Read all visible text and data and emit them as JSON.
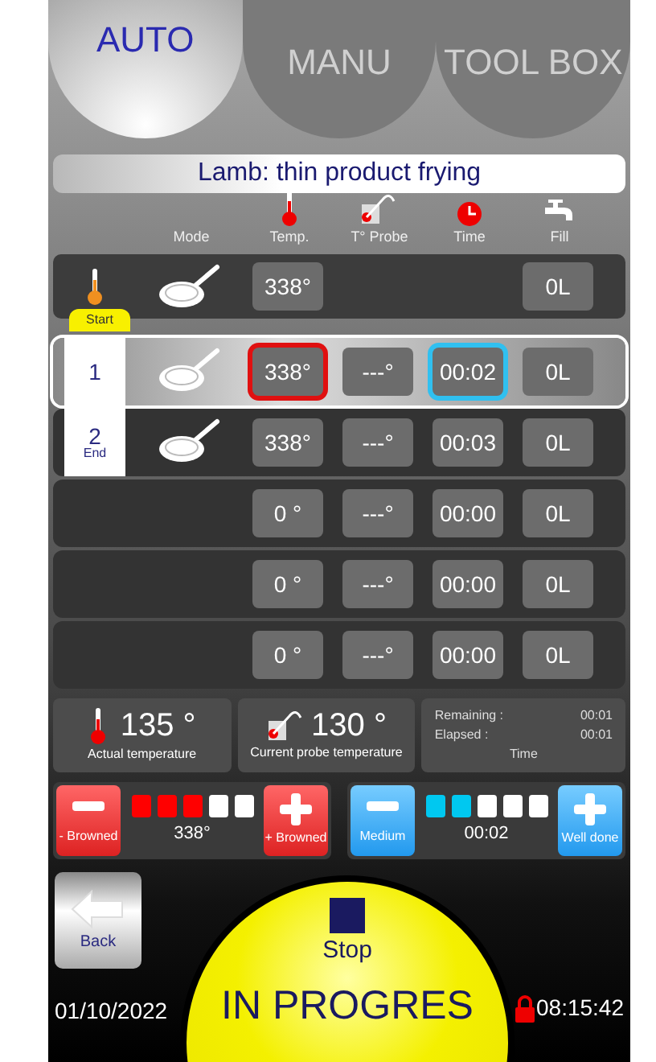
{
  "tabs": [
    {
      "label": "AUTO",
      "selected": true
    },
    {
      "label": "MANU",
      "selected": false
    },
    {
      "label": "TOOL BOX",
      "selected": false
    }
  ],
  "recipe_title": "Lamb: thin product frying",
  "columns": [
    "Mode",
    "Temp.",
    "T° Probe",
    "Time",
    "Fill"
  ],
  "preheat": {
    "temp": "338°",
    "fill": "0L",
    "start_label": "Start"
  },
  "steps": [
    {
      "number": "1",
      "pan": true,
      "temp": "338°",
      "probe": "---°",
      "time": "00:02",
      "fill": "0L",
      "selected": true
    },
    {
      "number": "2",
      "end_label": "End",
      "pan": true,
      "temp": "338°",
      "probe": "---°",
      "time": "00:03",
      "fill": "0L",
      "selected": false
    },
    {
      "pan": false,
      "temp": "0 °",
      "probe": "---°",
      "time": "00:00",
      "fill": "0L",
      "selected": false
    },
    {
      "pan": false,
      "temp": "0 °",
      "probe": "---°",
      "time": "00:00",
      "fill": "0L",
      "selected": false
    },
    {
      "pan": false,
      "temp": "0 °",
      "probe": "---°",
      "time": "00:00",
      "fill": "0L",
      "selected": false
    }
  ],
  "actual_temperature": {
    "value": "135 °",
    "label": "Actual temperature"
  },
  "probe_temperature": {
    "value": "130 °",
    "label": "Current probe temperature"
  },
  "time_info": {
    "remaining_label": "Remaining :",
    "remaining": "00:01",
    "elapsed_label": "Elapsed :",
    "elapsed": "00:01",
    "label": "Time"
  },
  "browning": {
    "minus_label": "- Browned",
    "plus_label": "+ Browned",
    "reading": "338°",
    "level": 0.6
  },
  "doneness": {
    "minus_label": "Medium",
    "plus_label": "Well done",
    "reading": "00:02",
    "level": 0.4
  },
  "back_label": "Back",
  "stop_label": "Stop",
  "status": "IN PROGRES",
  "date": "01/10/2022",
  "locked": true,
  "clock": "08:15:42"
}
